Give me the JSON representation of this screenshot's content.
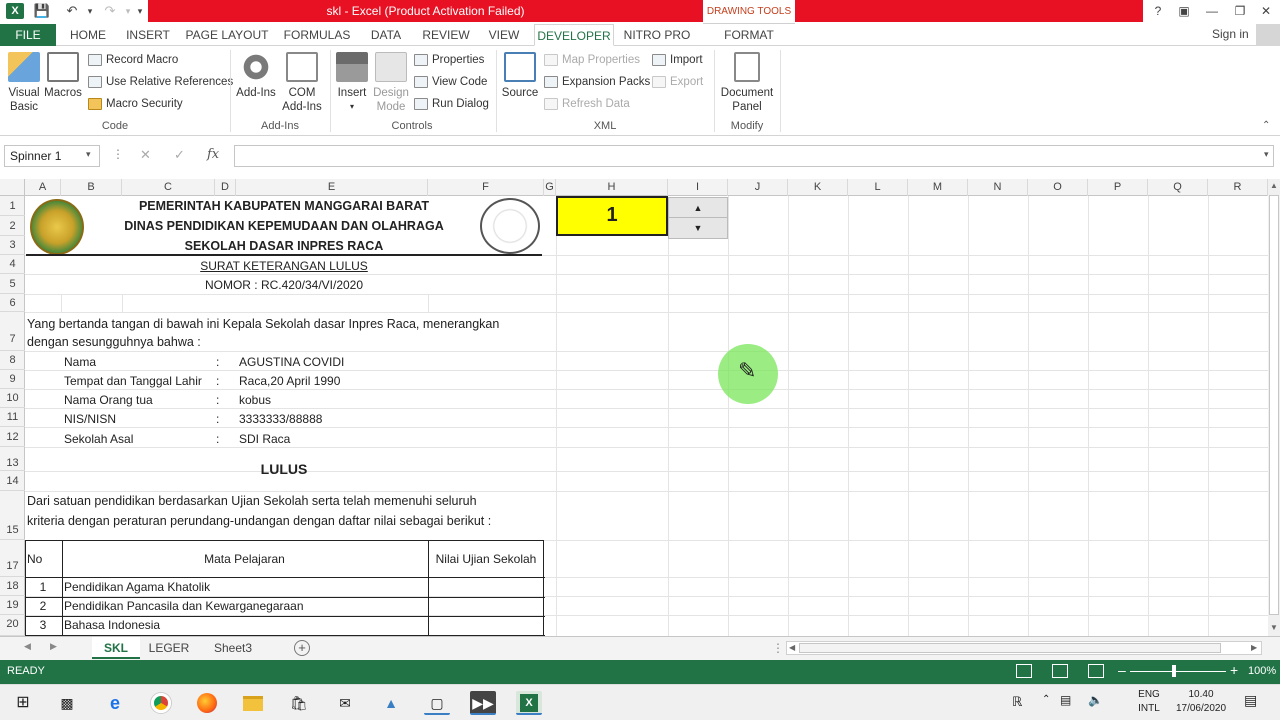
{
  "window": {
    "title": "skl  -  Excel (Product Activation Failed)",
    "contextual_tab_group": "DRAWING TOOLS",
    "sign_in": "Sign in",
    "app_icon": "excel-icon",
    "brand_color": "#217346",
    "alert_color": "#e81123"
  },
  "ribbon_tabs": [
    "FILE",
    "HOME",
    "INSERT",
    "PAGE LAYOUT",
    "FORMULAS",
    "DATA",
    "REVIEW",
    "VIEW",
    "DEVELOPER",
    "NITRO PRO",
    "FORMAT"
  ],
  "active_tab": "DEVELOPER",
  "ribbon": {
    "code": {
      "label": "Code",
      "visual_basic": "Visual Basic",
      "macros": "Macros",
      "record_macro": "Record Macro",
      "use_relative": "Use Relative References",
      "macro_security": "Macro Security"
    },
    "addins": {
      "label": "Add-Ins",
      "add_ins": "Add-Ins",
      "com_addins_1": "COM",
      "com_addins_2": "Add-Ins"
    },
    "controls": {
      "label": "Controls",
      "insert": "Insert",
      "design_1": "Design",
      "design_2": "Mode",
      "properties": "Properties",
      "view_code": "View Code",
      "run_dialog": "Run Dialog"
    },
    "xml": {
      "label": "XML",
      "source": "Source",
      "map_properties": "Map Properties",
      "expansion_packs": "Expansion Packs",
      "refresh_data": "Refresh Data",
      "import": "Import",
      "export": "Export"
    },
    "modify": {
      "label": "Modify",
      "doc_panel_1": "Document",
      "doc_panel_2": "Panel"
    }
  },
  "formula_bar": {
    "name_box": "Spinner 1",
    "fx": "fx",
    "formula": ""
  },
  "columns": [
    "A",
    "B",
    "C",
    "D",
    "E",
    "F",
    "G",
    "H",
    "I",
    "J",
    "K",
    "L",
    "M",
    "N",
    "O",
    "P",
    "Q",
    "R"
  ],
  "rows": [
    "1",
    "2",
    "3",
    "4",
    "5",
    "6",
    "7",
    "8",
    "9",
    "10",
    "11",
    "12",
    "13",
    "14",
    "15",
    "17",
    "18",
    "19",
    "20"
  ],
  "document": {
    "header_1": "PEMERINTAH KABUPATEN MANGGARAI BARAT",
    "header_2": "DINAS PENDIDIKAN KEPEMUDAAN DAN OLAHRAGA",
    "header_3": "SEKOLAH DASAR INPRES RACA",
    "subject": "SURAT KETERANGAN LULUS",
    "number": "NOMOR : RC.420/34/VI/2020",
    "intro_1": "Yang bertanda tangan di bawah ini Kepala Sekolah dasar Inpres Raca, menerangkan",
    "intro_2": "dengan sesungguhnya bahwa :",
    "fields": [
      {
        "label": "Nama",
        "sep": ":",
        "value": "AGUSTINA COVIDI"
      },
      {
        "label": "Tempat dan Tanggal Lahir",
        "sep": ":",
        "value": "Raca,20 April 1990"
      },
      {
        "label": "Nama Orang tua",
        "sep": ":",
        "value": "kobus"
      },
      {
        "label": "NIS/NISN",
        "sep": ":",
        "value": "3333333/88888"
      },
      {
        "label": "Sekolah Asal",
        "sep": ":",
        "value": "SDI Raca"
      }
    ],
    "result": "LULUS",
    "body_1": "Dari satuan pendidikan berdasarkan Ujian Sekolah serta telah memenuhi seluruh",
    "body_2": "kriteria dengan peraturan perundang-undangan dengan daftar nilai sebagai berikut :",
    "table_headers": {
      "no": "No",
      "subject": "Mata Pelajaran",
      "score": "Nilai Ujian Sekolah"
    },
    "table_rows": [
      {
        "no": "1",
        "subject": "Pendidikan Agama Khatolik"
      },
      {
        "no": "2",
        "subject": "Pendidikan Pancasila dan Kewarganegaraan"
      },
      {
        "no": "3",
        "subject": "Bahasa Indonesia"
      }
    ]
  },
  "spinner": {
    "value": "1",
    "cell_color": "#ffff00"
  },
  "sheet_tabs": [
    "SKL",
    "LEGER",
    "Sheet3"
  ],
  "active_sheet": "SKL",
  "status": {
    "ready": "READY",
    "zoom": "100%"
  },
  "taskbar": {
    "language_1": "ENG",
    "language_2": "INTL",
    "time": "10.40",
    "date": "17/06/2020"
  }
}
